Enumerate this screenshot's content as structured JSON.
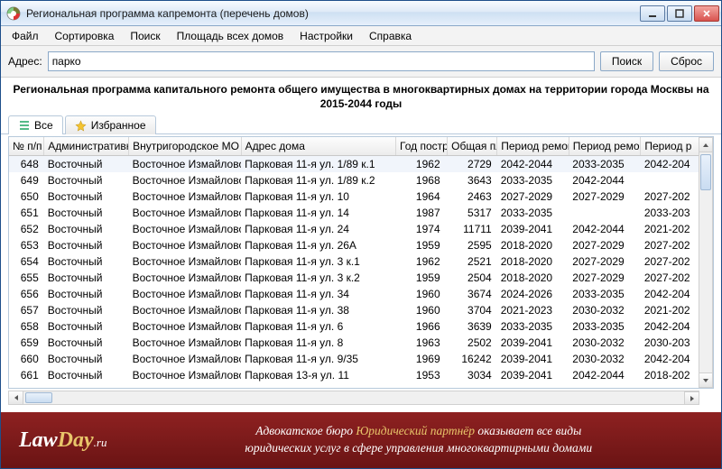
{
  "title": "Региональная программа капремонта (перечень домов)",
  "menu": [
    "Файл",
    "Сортировка",
    "Поиск",
    "Площадь всех домов",
    "Настройки",
    "Справка"
  ],
  "addrbar": {
    "label": "Адрес:",
    "value": "парко",
    "search": "Поиск",
    "reset": "Сброс"
  },
  "heading": "Региональная программа капитального ремонта общего имущества в многоквартирных домах на территории города Москвы на 2015-2044 годы",
  "tabs": [
    {
      "label": "Все",
      "icon": "list"
    },
    {
      "label": "Избранное",
      "icon": "star"
    }
  ],
  "columns": [
    "№ п/п",
    "Административный",
    "Внутригородское МО",
    "Адрес дома",
    "Год постр",
    "Общая пл",
    "Период ремонт",
    "Период ремонт",
    "Период р"
  ],
  "rows": [
    {
      "n": 648,
      "ao": "Восточный",
      "mo": "Восточное Измайлово",
      "addr": "Парковая 11-я ул. 1/89 к.1",
      "year": 1962,
      "sq": 2729,
      "p1": "2042-2044",
      "p2": "2033-2035",
      "p3": "2042-204"
    },
    {
      "n": 649,
      "ao": "Восточный",
      "mo": "Восточное Измайлово",
      "addr": "Парковая 11-я ул. 1/89 к.2",
      "year": 1968,
      "sq": 3643,
      "p1": "2033-2035",
      "p2": "2042-2044",
      "p3": ""
    },
    {
      "n": 650,
      "ao": "Восточный",
      "mo": "Восточное Измайлово",
      "addr": "Парковая 11-я ул. 10",
      "year": 1964,
      "sq": 2463,
      "p1": "2027-2029",
      "p2": "2027-2029",
      "p3": "2027-202"
    },
    {
      "n": 651,
      "ao": "Восточный",
      "mo": "Восточное Измайлово",
      "addr": "Парковая 11-я ул. 14",
      "year": 1987,
      "sq": 5317,
      "p1": "2033-2035",
      "p2": "",
      "p3": "2033-203"
    },
    {
      "n": 652,
      "ao": "Восточный",
      "mo": "Восточное Измайлово",
      "addr": "Парковая 11-я ул. 24",
      "year": 1974,
      "sq": 11711,
      "p1": "2039-2041",
      "p2": "2042-2044",
      "p3": "2021-202"
    },
    {
      "n": 653,
      "ao": "Восточный",
      "mo": "Восточное Измайлово",
      "addr": "Парковая 11-я ул. 26А",
      "year": 1959,
      "sq": 2595,
      "p1": "2018-2020",
      "p2": "2027-2029",
      "p3": "2027-202"
    },
    {
      "n": 654,
      "ao": "Восточный",
      "mo": "Восточное Измайлово",
      "addr": "Парковая 11-я ул. 3 к.1",
      "year": 1962,
      "sq": 2521,
      "p1": "2018-2020",
      "p2": "2027-2029",
      "p3": "2027-202"
    },
    {
      "n": 655,
      "ao": "Восточный",
      "mo": "Восточное Измайлово",
      "addr": "Парковая 11-я ул. 3 к.2",
      "year": 1959,
      "sq": 2504,
      "p1": "2018-2020",
      "p2": "2027-2029",
      "p3": "2027-202"
    },
    {
      "n": 656,
      "ao": "Восточный",
      "mo": "Восточное Измайлово",
      "addr": "Парковая 11-я ул. 34",
      "year": 1960,
      "sq": 3674,
      "p1": "2024-2026",
      "p2": "2033-2035",
      "p3": "2042-204"
    },
    {
      "n": 657,
      "ao": "Восточный",
      "mo": "Восточное Измайлово",
      "addr": "Парковая 11-я ул. 38",
      "year": 1960,
      "sq": 3704,
      "p1": "2021-2023",
      "p2": "2030-2032",
      "p3": "2021-202"
    },
    {
      "n": 658,
      "ao": "Восточный",
      "mo": "Восточное Измайлово",
      "addr": "Парковая 11-я ул. 6",
      "year": 1966,
      "sq": 3639,
      "p1": "2033-2035",
      "p2": "2033-2035",
      "p3": "2042-204"
    },
    {
      "n": 659,
      "ao": "Восточный",
      "mo": "Восточное Измайлово",
      "addr": "Парковая 11-я ул. 8",
      "year": 1963,
      "sq": 2502,
      "p1": "2039-2041",
      "p2": "2030-2032",
      "p3": "2030-203"
    },
    {
      "n": 660,
      "ao": "Восточный",
      "mo": "Восточное Измайлово",
      "addr": "Парковая 11-я ул. 9/35",
      "year": 1969,
      "sq": 16242,
      "p1": "2039-2041",
      "p2": "2030-2032",
      "p3": "2042-204"
    },
    {
      "n": 661,
      "ao": "Восточный",
      "mo": "Восточное Измайлово",
      "addr": "Парковая 13-я ул. 11",
      "year": 1953,
      "sq": 3034,
      "p1": "2039-2041",
      "p2": "2042-2044",
      "p3": "2018-202"
    }
  ],
  "footer": {
    "logo_law": "Law",
    "logo_day": "Day",
    "logo_ru": ".ru",
    "line1a": "Адвокатское бюро ",
    "line1b": "Юридический партнёр",
    "line1c": " оказывает все виды",
    "line2": "юридических услуг в сфере управления многоквартирными домами"
  }
}
